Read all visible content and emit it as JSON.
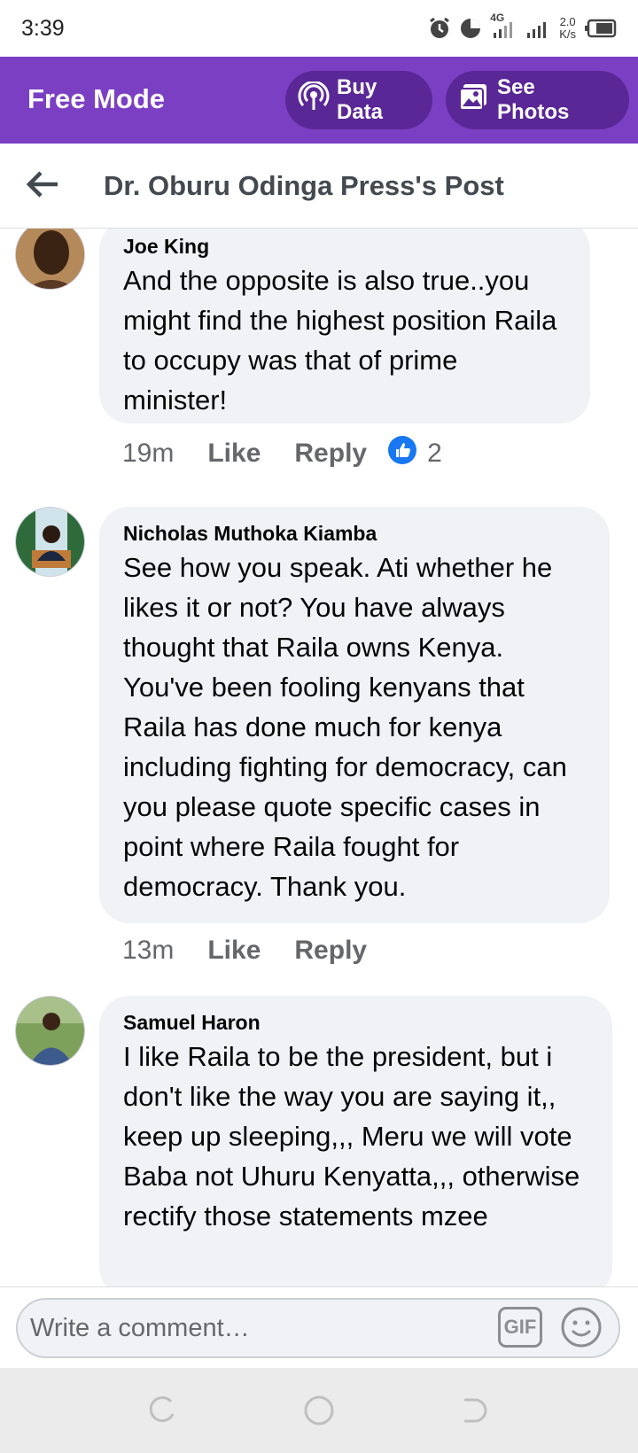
{
  "status_bar": {
    "time": "3:39",
    "network": "4G",
    "speed_value": "2.0",
    "speed_unit": "K/s"
  },
  "free_mode": {
    "title": "Free Mode",
    "buy_data_label": "Buy Data",
    "see_photos_label": "See Photos",
    "accent_color": "#7b3fc4"
  },
  "header": {
    "title": "Dr. Oburu Odinga Press's Post"
  },
  "comments": [
    {
      "author": "Joe King",
      "text": "And the opposite is also true..you might find the highest position Raila to occupy was that of prime minister!",
      "time": "19m",
      "like_label": "Like",
      "reply_label": "Reply",
      "reaction_count": "2",
      "reaction_icon": "thumbs-up-icon"
    },
    {
      "author": "Nicholas Muthoka Kiamba",
      "text": "See how you speak. Ati whether he likes it or not? You have always thought that Raila  owns Kenya. You've been fooling kenyans that Raila has done much for kenya including fighting for democracy, can you please quote specific cases in point where Raila fought for democracy. Thank you.",
      "time": "13m",
      "like_label": "Like",
      "reply_label": "Reply"
    },
    {
      "author": "Samuel Haron",
      "text": "I like Raila to be the president, but i don't like the way you are saying it,, keep up sleeping,,, Meru we will vote Baba not Uhuru Kenyatta,,, otherwise rectify those statements mzee"
    }
  ],
  "composer": {
    "placeholder": "Write a comment…",
    "gif_label": "GIF"
  }
}
